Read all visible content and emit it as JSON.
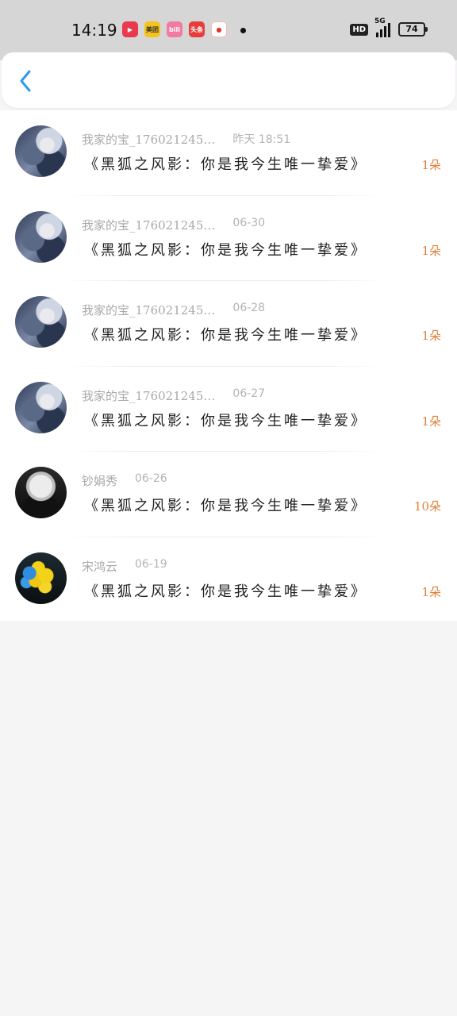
{
  "status_bar": {
    "time": "14:19",
    "apps": [
      {
        "icon": "video-app-icon",
        "label": "▶",
        "color": "#e8394e"
      },
      {
        "icon": "meituan-app-icon",
        "label": "美团",
        "color": "#f6c31a"
      },
      {
        "icon": "bilibili-app-icon",
        "label": "bili",
        "color": "#f07aa0"
      },
      {
        "icon": "toutiao-app-icon",
        "label": "头条",
        "color": "#ea3b3b"
      },
      {
        "icon": "weibo-app-icon",
        "label": "●",
        "color": "#e0342d"
      }
    ],
    "hd": "HD",
    "network": "5G",
    "battery": "74"
  },
  "nav": {
    "back_icon": "chevron-left-icon",
    "accent": "#2b9bef"
  },
  "records": [
    {
      "user": "我家的宝_176021245…",
      "date": "昨天 18:51",
      "title": "《黑狐之风影：你是我今生唯一挚爱》",
      "count": "1朵",
      "avatar": "anime"
    },
    {
      "user": "我家的宝_176021245…",
      "date": "06-30",
      "title": "《黑狐之风影：你是我今生唯一挚爱》",
      "count": "1朵",
      "avatar": "anime"
    },
    {
      "user": "我家的宝_176021245…",
      "date": "06-28",
      "title": "《黑狐之风影：你是我今生唯一挚爱》",
      "count": "1朵",
      "avatar": "anime"
    },
    {
      "user": "我家的宝_176021245…",
      "date": "06-27",
      "title": "《黑狐之风影：你是我今生唯一挚爱》",
      "count": "1朵",
      "avatar": "anime"
    },
    {
      "user": "钞娟秀",
      "date": "06-26",
      "title": "《黑狐之风影：你是我今生唯一挚爱》",
      "count": "10朵",
      "avatar": "bw"
    },
    {
      "user": "宋鸿云",
      "date": "06-19",
      "title": "《黑狐之风影：你是我今生唯一挚爱》",
      "count": "1朵",
      "avatar": "balloon"
    }
  ],
  "colors": {
    "count": "#e0803a",
    "meta": "#a9a9a9",
    "title": "#222222"
  }
}
